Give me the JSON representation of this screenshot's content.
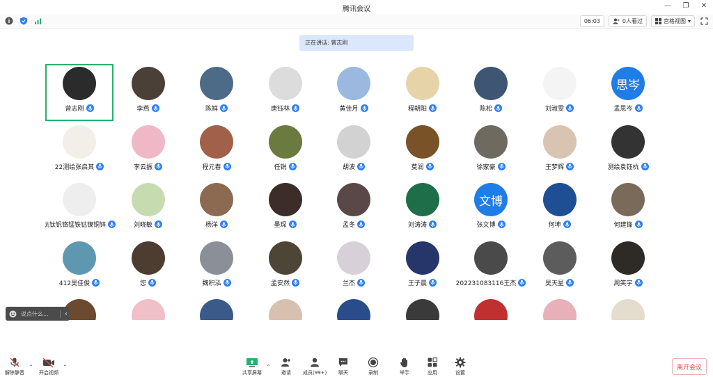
{
  "window": {
    "title": "腾讯会议"
  },
  "topbar": {
    "timer": "06:03",
    "viewers": "0人看过",
    "view_mode": "宫格视图"
  },
  "speaking": "正在讲话: 曾志刚",
  "participants": [
    {
      "name": "曾志刚",
      "active": true,
      "bg": "#2b2b2b"
    },
    {
      "name": "李燕",
      "bg": "#4a4038"
    },
    {
      "name": "陈鲜",
      "bg": "#4d6a86"
    },
    {
      "name": "唐钰林",
      "bg": "#dcdcdc"
    },
    {
      "name": "黄佳月",
      "bg": "#9ab8e0"
    },
    {
      "name": "程朝阳",
      "bg": "#e6d4a8"
    },
    {
      "name": "陈松",
      "bg": "#3e5574"
    },
    {
      "name": "刘淑雯",
      "bg": "#f4f4f4"
    },
    {
      "name": "孟思岑",
      "bg": "#1f7de8",
      "text": "思岑"
    },
    {
      "name": "22测绘张启其",
      "bg": "#f2efe8"
    },
    {
      "name": "李云振",
      "bg": "#f0b8c6"
    },
    {
      "name": "程元春",
      "bg": "#a0604a"
    },
    {
      "name": "任锐",
      "bg": "#6b7a3e"
    },
    {
      "name": "胡波",
      "bg": "#d2d2d2"
    },
    {
      "name": "莫润",
      "bg": "#7a5228"
    },
    {
      "name": "徐家豪",
      "bg": "#6f6a60"
    },
    {
      "name": "王梦辉",
      "bg": "#d8c4b0"
    },
    {
      "name": "测绘袁钰杭",
      "bg": "#333333"
    },
    {
      "name": "钪钛钒铬锰铁钴镍铜锌",
      "bg": "#eeeeee"
    },
    {
      "name": "刘晓敏",
      "bg": "#c6dcb0"
    },
    {
      "name": "杨洋",
      "bg": "#8c6a52"
    },
    {
      "name": "墨琛",
      "bg": "#3d2d2a"
    },
    {
      "name": "孟冬",
      "bg": "#5a4848"
    },
    {
      "name": "刘涛涛",
      "bg": "#1f6e4a"
    },
    {
      "name": "张文博",
      "bg": "#1f7de8",
      "text": "文博"
    },
    {
      "name": "何坤",
      "bg": "#1e4f94"
    },
    {
      "name": "何建锋",
      "bg": "#7a6a5a"
    },
    {
      "name": "412吴佳俊",
      "bg": "#5e98b0"
    },
    {
      "name": "您",
      "bg": "#4d3c30"
    },
    {
      "name": "魏积泓",
      "bg": "#8a8f98"
    },
    {
      "name": "孟安然",
      "bg": "#4d4636"
    },
    {
      "name": "兰杰",
      "bg": "#d8d0d8"
    },
    {
      "name": "王子晨",
      "bg": "#26366a"
    },
    {
      "name": "202231083116王杰",
      "bg": "#4a4a4a"
    },
    {
      "name": "吴天星",
      "bg": "#5c5c5c"
    },
    {
      "name": "周笑宇",
      "bg": "#2e2a26"
    },
    {
      "name": "",
      "bg": "#6b4a30"
    },
    {
      "name": "",
      "bg": "#f0c0c8"
    },
    {
      "name": "",
      "bg": "#3b5a8a"
    },
    {
      "name": "",
      "bg": "#d8c0b0"
    },
    {
      "name": "",
      "bg": "#2a4c8a"
    },
    {
      "name": "",
      "bg": "#3a3a3a"
    },
    {
      "name": "",
      "bg": "#c03030"
    },
    {
      "name": "",
      "bg": "#e8b0b8"
    },
    {
      "name": "",
      "bg": "#e4dccc"
    }
  ],
  "chat_input": {
    "placeholder": "说点什么..."
  },
  "toolbar": {
    "unmute": "解除静音",
    "start_video": "开启视频",
    "share_screen": "共享屏幕",
    "invite": "邀请",
    "members": "成员(99+)",
    "chat": "聊天",
    "record": "录制",
    "raise_hand": "举手",
    "apps": "应用",
    "settings": "设置",
    "leave": "离开会议"
  },
  "colors": {
    "accent": "#2f7ff5",
    "active_border": "#27b06f",
    "leave_text": "#e0463a"
  }
}
